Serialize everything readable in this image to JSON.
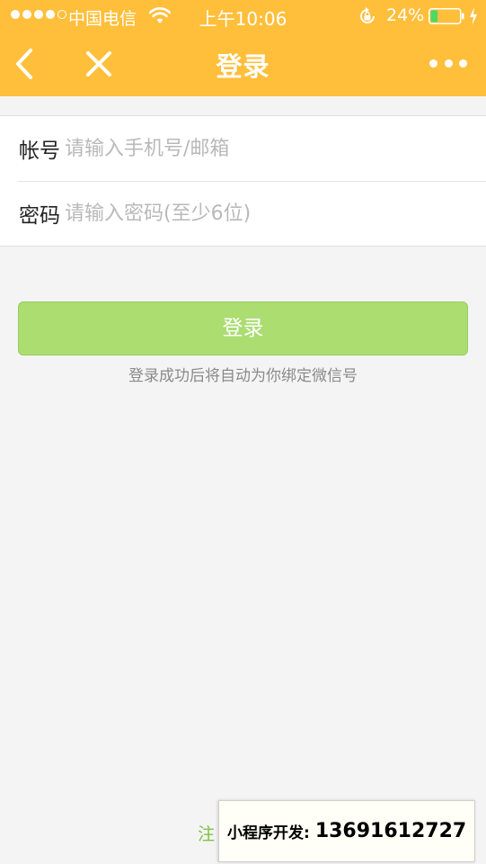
{
  "status_bar": {
    "carrier": "中国电信",
    "time": "上午10:06",
    "battery": "24%",
    "battery_level": 0.24
  },
  "nav": {
    "title": "登录",
    "back_icon": "chevron-left-icon",
    "close_icon": "close-icon",
    "more_icon": "more-dots-icon"
  },
  "form": {
    "account": {
      "label": "帐号",
      "placeholder": "请输入手机号/邮箱",
      "value": ""
    },
    "password": {
      "label": "密码",
      "placeholder": "请输入密码(至少6位)",
      "value": ""
    }
  },
  "login_button": "登录",
  "hint": "登录成功后将自动为你绑定微信号",
  "register_link": "注",
  "promo": {
    "label": "小程序开发:",
    "phone": "13691612727"
  },
  "colors": {
    "header": "#ffbf3b",
    "button": "#abdd71",
    "link": "#7fc242",
    "background": "#f4f4f4"
  }
}
